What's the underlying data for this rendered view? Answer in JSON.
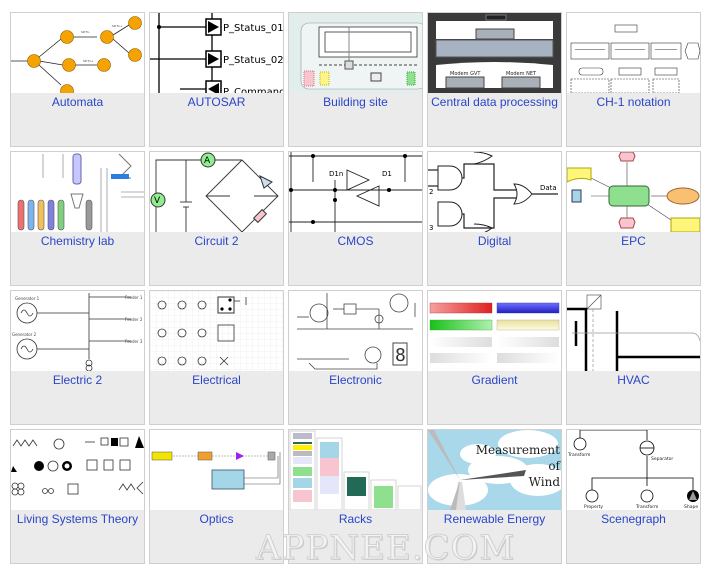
{
  "gallery": {
    "items": [
      {
        "label": "Automata",
        "thumb": "automata-diagram"
      },
      {
        "label": "AUTOSAR",
        "thumb": "autosar-diagram",
        "texts": [
          "P_Status_01",
          "P_Status_02",
          "P_Command"
        ]
      },
      {
        "label": "Building site",
        "thumb": "building-site-diagram"
      },
      {
        "label": "Central data processing",
        "thumb": "rack-diagram",
        "texts": [
          "Modem GVT",
          "Modem NET"
        ]
      },
      {
        "label": "CH-1 notation",
        "thumb": "ch1-notation-diagram"
      },
      {
        "label": "Chemistry lab",
        "thumb": "chemistry-lab-diagram"
      },
      {
        "label": "Circuit 2",
        "thumb": "circuit-diagram",
        "texts": [
          "A",
          "V"
        ]
      },
      {
        "label": "CMOS",
        "thumb": "cmos-diagram",
        "texts": [
          "D1n",
          "D1"
        ]
      },
      {
        "label": "Digital",
        "thumb": "digital-logic-diagram",
        "texts": [
          "Data",
          "2",
          "3"
        ]
      },
      {
        "label": "EPC",
        "thumb": "epc-diagram"
      },
      {
        "label": "Electric 2",
        "thumb": "electric-diagram",
        "texts": [
          "Generator 1",
          "Generator 2",
          "Feeder 1",
          "Feeder 2",
          "Feeder 3"
        ]
      },
      {
        "label": "Electrical",
        "thumb": "electrical-symbols-diagram"
      },
      {
        "label": "Electronic",
        "thumb": "electronic-diagram",
        "texts": [
          "8"
        ]
      },
      {
        "label": "Gradient",
        "thumb": "gradient-boxes-diagram"
      },
      {
        "label": "HVAC",
        "thumb": "hvac-diagram"
      },
      {
        "label": "Living Systems Theory",
        "thumb": "living-systems-diagram"
      },
      {
        "label": "Optics",
        "thumb": "optics-diagram"
      },
      {
        "label": "Racks",
        "thumb": "racks-diagram"
      },
      {
        "label": "Renewable Energy",
        "thumb": "wind-turbine-diagram",
        "texts": [
          "Measurement",
          "of",
          "Wind"
        ]
      },
      {
        "label": "Scenegraph",
        "thumb": "scenegraph-diagram",
        "texts": [
          "Transform",
          "Separator",
          "Property",
          "Transform",
          "Shape"
        ]
      }
    ]
  },
  "watermark": "APPNEE.COM"
}
